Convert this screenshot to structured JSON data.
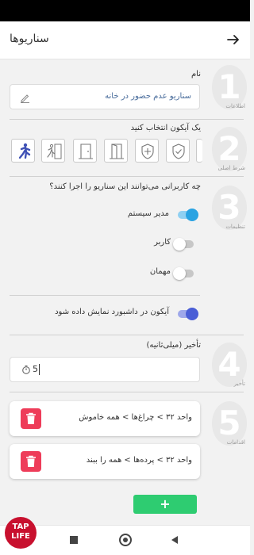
{
  "appbar": {
    "title": "سناریوها"
  },
  "step1": {
    "number": "1",
    "side_label": "اطلاعات",
    "name_label": "نام",
    "name_value": "سناریو عدم حضور در خانه"
  },
  "step2": {
    "number": "2",
    "side_label": "شرط اصلی",
    "icon_label": "یک آیکون انتخاب کنید",
    "icons": [
      "running-person-icon",
      "exit-person-icon",
      "door-closed-icon",
      "door-open-icon",
      "shield-cross-icon",
      "shield-check-icon"
    ]
  },
  "step3": {
    "number": "3",
    "side_label": "تنظیمات",
    "question": "چه کاربرانی می‌توانند این سناریو را اجرا کنند؟",
    "users": [
      {
        "label": "مدیر سیستم",
        "on": true
      },
      {
        "label": "کاربر",
        "on": false
      },
      {
        "label": "مهمان",
        "on": false
      }
    ],
    "dashboard_label": "آیکون در داشبورد نمایش داده شود",
    "dashboard_on": true
  },
  "step4": {
    "number": "4",
    "side_label": "تأخیر",
    "delay_label": "تأخیر (میلی‌ثانیه)",
    "delay_value": "5"
  },
  "step5": {
    "number": "5",
    "side_label": "اقدامات",
    "actions": [
      "واحد ۳۲ > چراغ‌ها > همه خاموش",
      "واحد ۳۲ > پرده‌ها > همه را ببند"
    ],
    "add_label": "+"
  },
  "logo": {
    "line1": "TAP",
    "line2": "LIFE"
  },
  "colors": {
    "toggle_on": "#2aa3e2",
    "toggle_on_blue": "#4a5ed6",
    "delete": "#ee3c59",
    "add": "#2ecc71",
    "icon_selected": "#3f51b5"
  }
}
